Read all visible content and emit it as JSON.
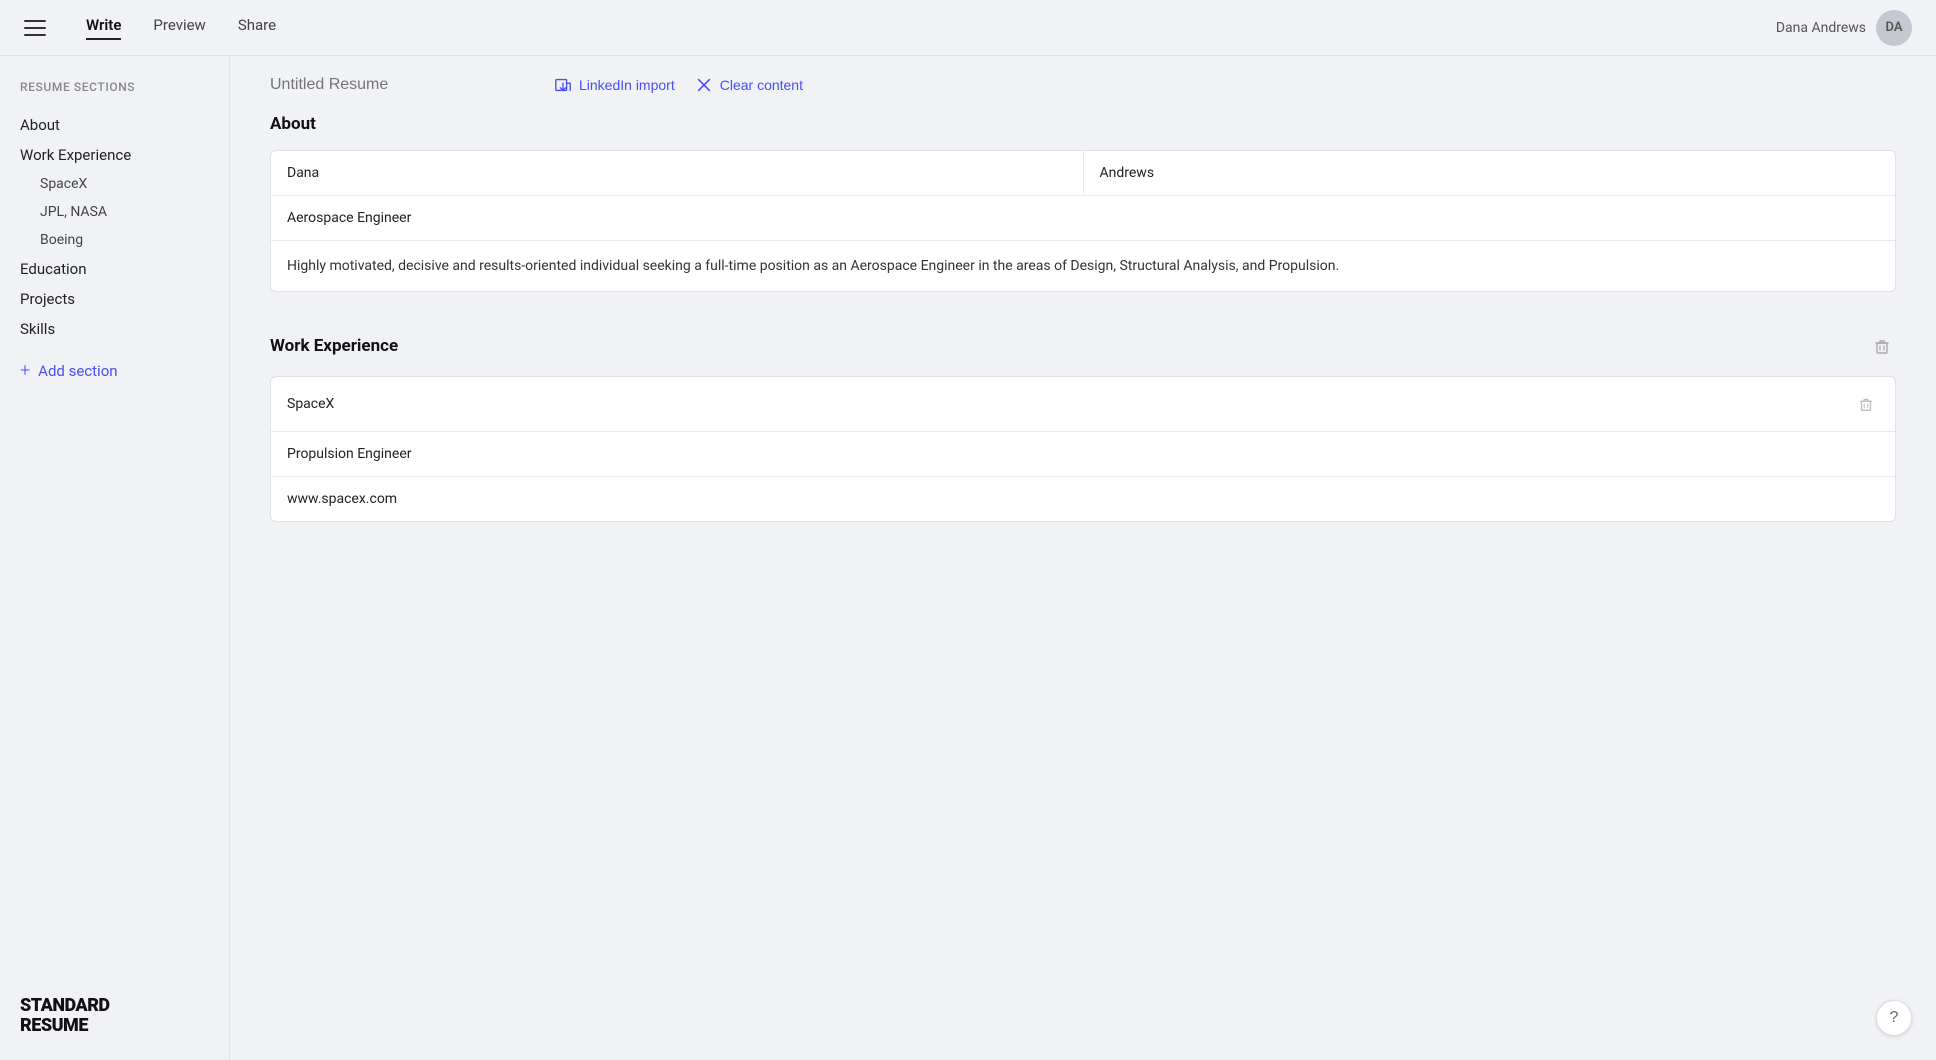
{
  "nav": {
    "tabs": [
      {
        "label": "Write",
        "active": true
      },
      {
        "label": "Preview",
        "active": false
      },
      {
        "label": "Share",
        "active": false
      }
    ],
    "user": {
      "name": "Dana Andrews",
      "initials": "DA"
    }
  },
  "sidebar": {
    "title": "Resume sections",
    "items": [
      {
        "label": "About",
        "sub": false
      },
      {
        "label": "Work Experience",
        "sub": false
      },
      {
        "label": "SpaceX",
        "sub": true
      },
      {
        "label": "JPL, NASA",
        "sub": true
      },
      {
        "label": "Boeing",
        "sub": true
      },
      {
        "label": "Education",
        "sub": false
      },
      {
        "label": "Projects",
        "sub": false
      },
      {
        "label": "Skills",
        "sub": false
      }
    ],
    "add_label": "Add section",
    "logo_line1": "STANDARD",
    "logo_line2": "RESUME"
  },
  "resume": {
    "title_placeholder": "Untitled Resume",
    "linkedin_label": "LinkedIn import",
    "clear_label": "Clear content"
  },
  "about_section": {
    "title": "About",
    "first_name": "Dana",
    "last_name": "Andrews",
    "job_title": "Aerospace Engineer",
    "summary": "Highly motivated, decisive and results-oriented individual seeking a full-time position as an Aerospace Engineer in the areas of Design, Structural Analysis, and Propulsion."
  },
  "work_experience_section": {
    "title": "Work Experience",
    "company": "SpaceX",
    "role": "Propulsion Engineer",
    "website": "www.spacex.com"
  },
  "help": {
    "label": "?"
  }
}
